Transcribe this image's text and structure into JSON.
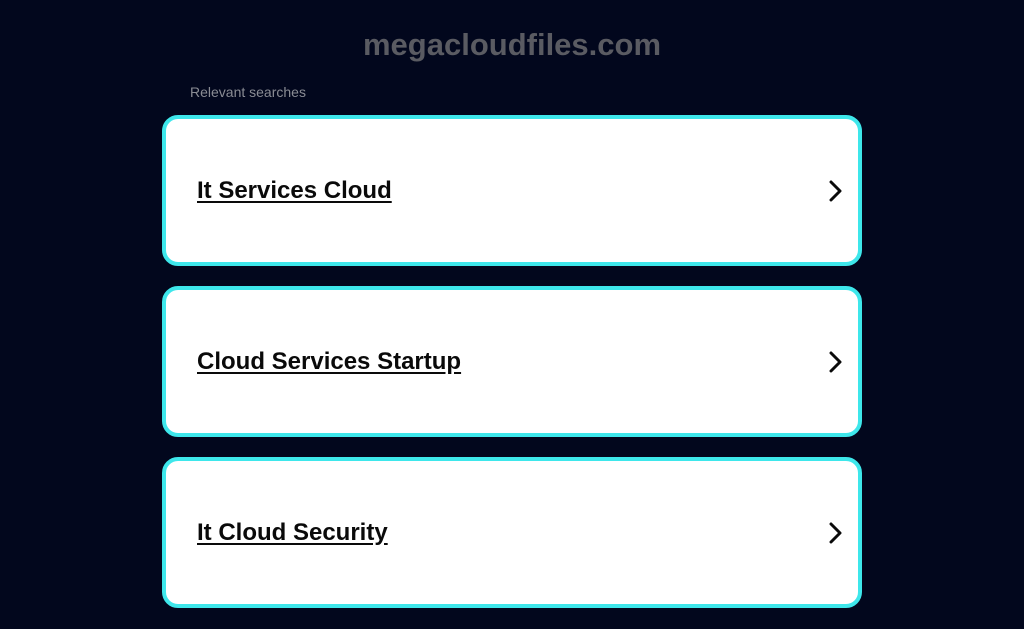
{
  "header": {
    "site_title": "megacloudfiles.com"
  },
  "section": {
    "label": "Relevant searches"
  },
  "results": [
    {
      "label": "It Services Cloud",
      "icon": "chevron-right-icon"
    },
    {
      "label": "Cloud Services Startup",
      "icon": "chevron-right-icon"
    },
    {
      "label": "It Cloud Security",
      "icon": "chevron-right-icon"
    }
  ],
  "colors": {
    "background": "#02071d",
    "card_border": "#3ee7eb",
    "card_background": "#ffffff",
    "title_text": "#5a5b62",
    "label_text": "#8a8c94"
  }
}
